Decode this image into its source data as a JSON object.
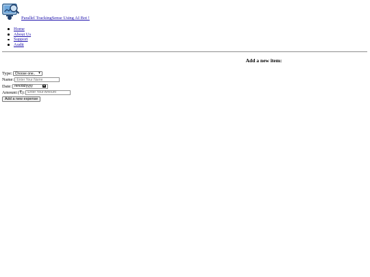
{
  "header": {
    "brand_text": "Parallel TrackingSense Using AI Bot !",
    "logo_icon": "chart-magnifier-logo-icon"
  },
  "nav": {
    "items": [
      {
        "label": "Home"
      },
      {
        "label": "About Us"
      },
      {
        "label": "Support"
      },
      {
        "label": "Audit"
      }
    ]
  },
  "form": {
    "title": "Add a new item:",
    "type_label": "Type:",
    "type_selected": "Choose one..",
    "name_label": "Name:",
    "name_placeholder": "Enter Your Name",
    "date_label": "Date:",
    "date_placeholder": "mm/dd/yyyy",
    "amount_label": "Amount (₹):",
    "amount_placeholder": "Enter Your Amount",
    "submit_label": "Add a new expense"
  },
  "colors": {
    "link": "#1a0dab",
    "logo_accent": "#2a5d8f"
  }
}
